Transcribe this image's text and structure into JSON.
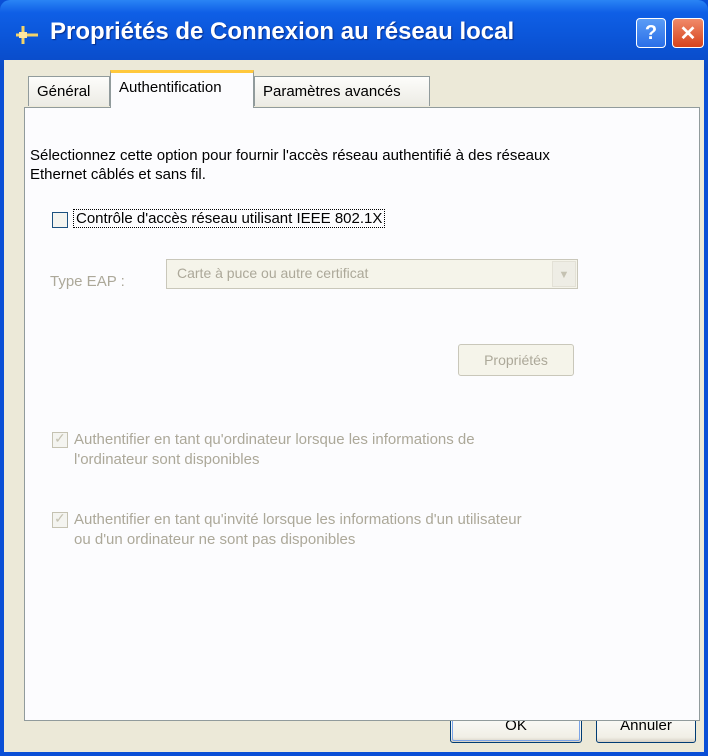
{
  "window": {
    "title": "Propriétés de Connexion au réseau local",
    "help_icon": "help-icon",
    "close_icon": "close-icon",
    "colors": {
      "title_bar": "#0b55d8",
      "client": "#ece9d8",
      "tab_accent": "#ffc83c"
    }
  },
  "tabs": [
    {
      "label": "Général"
    },
    {
      "label": "Authentification",
      "selected": true
    },
    {
      "label": "Paramètres avancés"
    }
  ],
  "auth": {
    "description": "Sélectionnez cette option pour fournir l'accès réseau authentifié à des réseaux Ethernet câblés et sans fil.",
    "ieee_label": "Contrôle d'accès réseau utilisant IEEE 802.1X",
    "ieee_checked": false,
    "eap_type_label": "Type EAP :",
    "eap_type_value": "Carte à puce ou autre certificat",
    "properties_button": "Propriétés",
    "auth_computer_label": "Authentifier en tant qu'ordinateur lorsque les informations de l'ordinateur sont disponibles",
    "auth_computer_checked": true,
    "auth_guest_label": "Authentifier en tant qu'invité lorsque les informations d'un utilisateur ou d'un ordinateur ne sont pas disponibles",
    "auth_guest_checked": true
  },
  "footer": {
    "ok_button": "OK",
    "cancel_button": "Annuler"
  }
}
